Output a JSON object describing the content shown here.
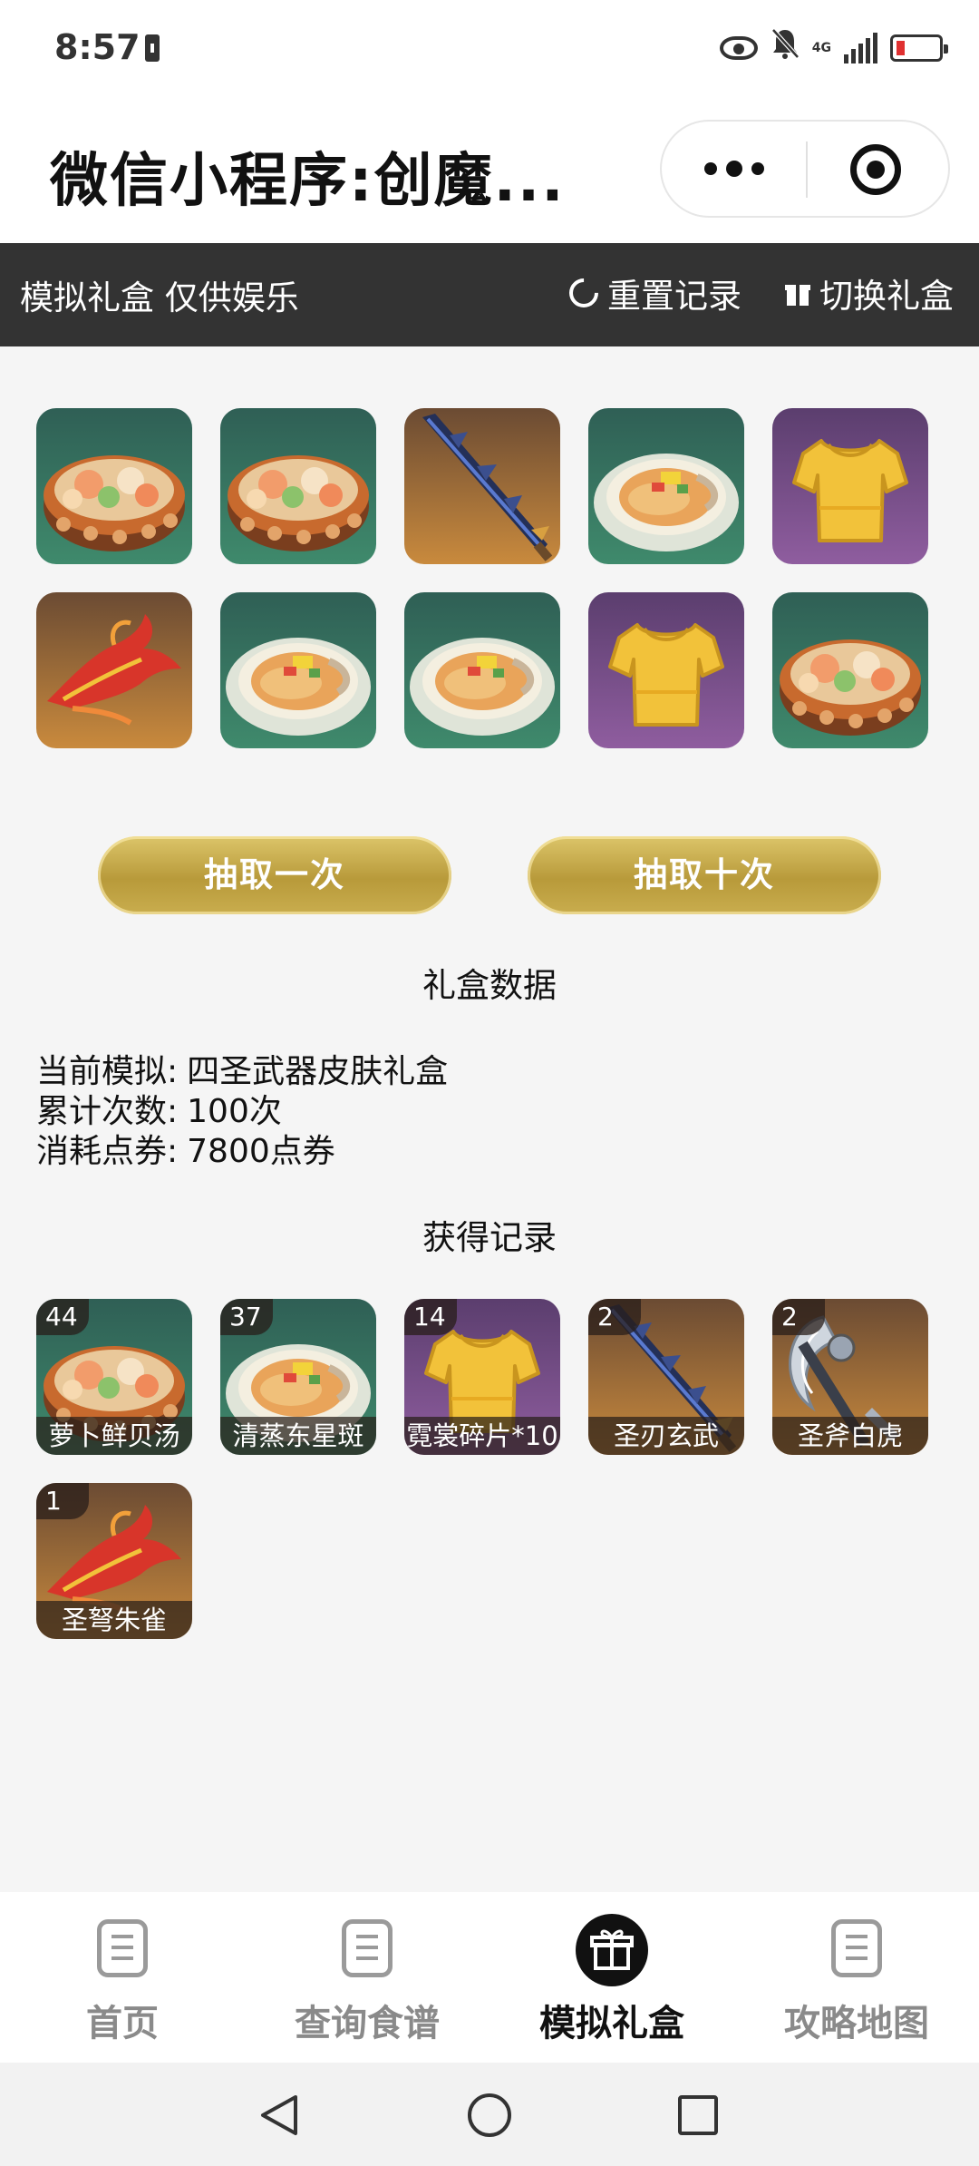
{
  "status_bar": {
    "time": "8:57",
    "network": "4G"
  },
  "title_bar": {
    "title": "微信小程序:创魔..."
  },
  "toolbar": {
    "title": "模拟礼盒 仅供娱乐",
    "reset_label": "重置记录",
    "switch_label": "切换礼盒"
  },
  "draw_results": [
    {
      "item": "soup",
      "bg": "green"
    },
    {
      "item": "soup",
      "bg": "green"
    },
    {
      "item": "sword",
      "bg": "orange"
    },
    {
      "item": "fish-dish",
      "bg": "green"
    },
    {
      "item": "shirt",
      "bg": "purple"
    },
    {
      "item": "phoenix",
      "bg": "orange"
    },
    {
      "item": "fish-dish",
      "bg": "green"
    },
    {
      "item": "fish-dish",
      "bg": "green"
    },
    {
      "item": "shirt",
      "bg": "purple"
    },
    {
      "item": "soup",
      "bg": "green"
    }
  ],
  "buttons": {
    "draw_once": "抽取一次",
    "draw_ten": "抽取十次"
  },
  "box_data": {
    "heading": "礼盒数据",
    "current_label": "当前模拟:",
    "current_value": "四圣武器皮肤礼盒",
    "count_label": "累计次数:",
    "count_value": "100次",
    "cost_label": "消耗点券:",
    "cost_value": "7800点券"
  },
  "records": {
    "heading": "获得记录",
    "items": [
      {
        "count": "44",
        "name": "萝卜鲜贝汤",
        "item": "soup",
        "bg": "green"
      },
      {
        "count": "37",
        "name": "清蒸东星斑",
        "item": "fish-dish",
        "bg": "green"
      },
      {
        "count": "14",
        "name": "霓裳碎片*10",
        "item": "shirt",
        "bg": "purple"
      },
      {
        "count": "2",
        "name": "圣刃玄武",
        "item": "sword",
        "bg": "orange"
      },
      {
        "count": "2",
        "name": "圣斧白虎",
        "item": "axe",
        "bg": "orange"
      },
      {
        "count": "1",
        "name": "圣弩朱雀",
        "item": "phoenix",
        "bg": "orange"
      }
    ]
  },
  "tabbar": {
    "tabs": [
      {
        "label": "首页",
        "active": false
      },
      {
        "label": "查询食谱",
        "active": false
      },
      {
        "label": "模拟礼盒",
        "active": true
      },
      {
        "label": "攻略地图",
        "active": false
      }
    ]
  },
  "colors": {
    "toolbar_bg": "#333333",
    "button_gold": "#c9ad4e",
    "page_bg": "#f5f5f5"
  }
}
